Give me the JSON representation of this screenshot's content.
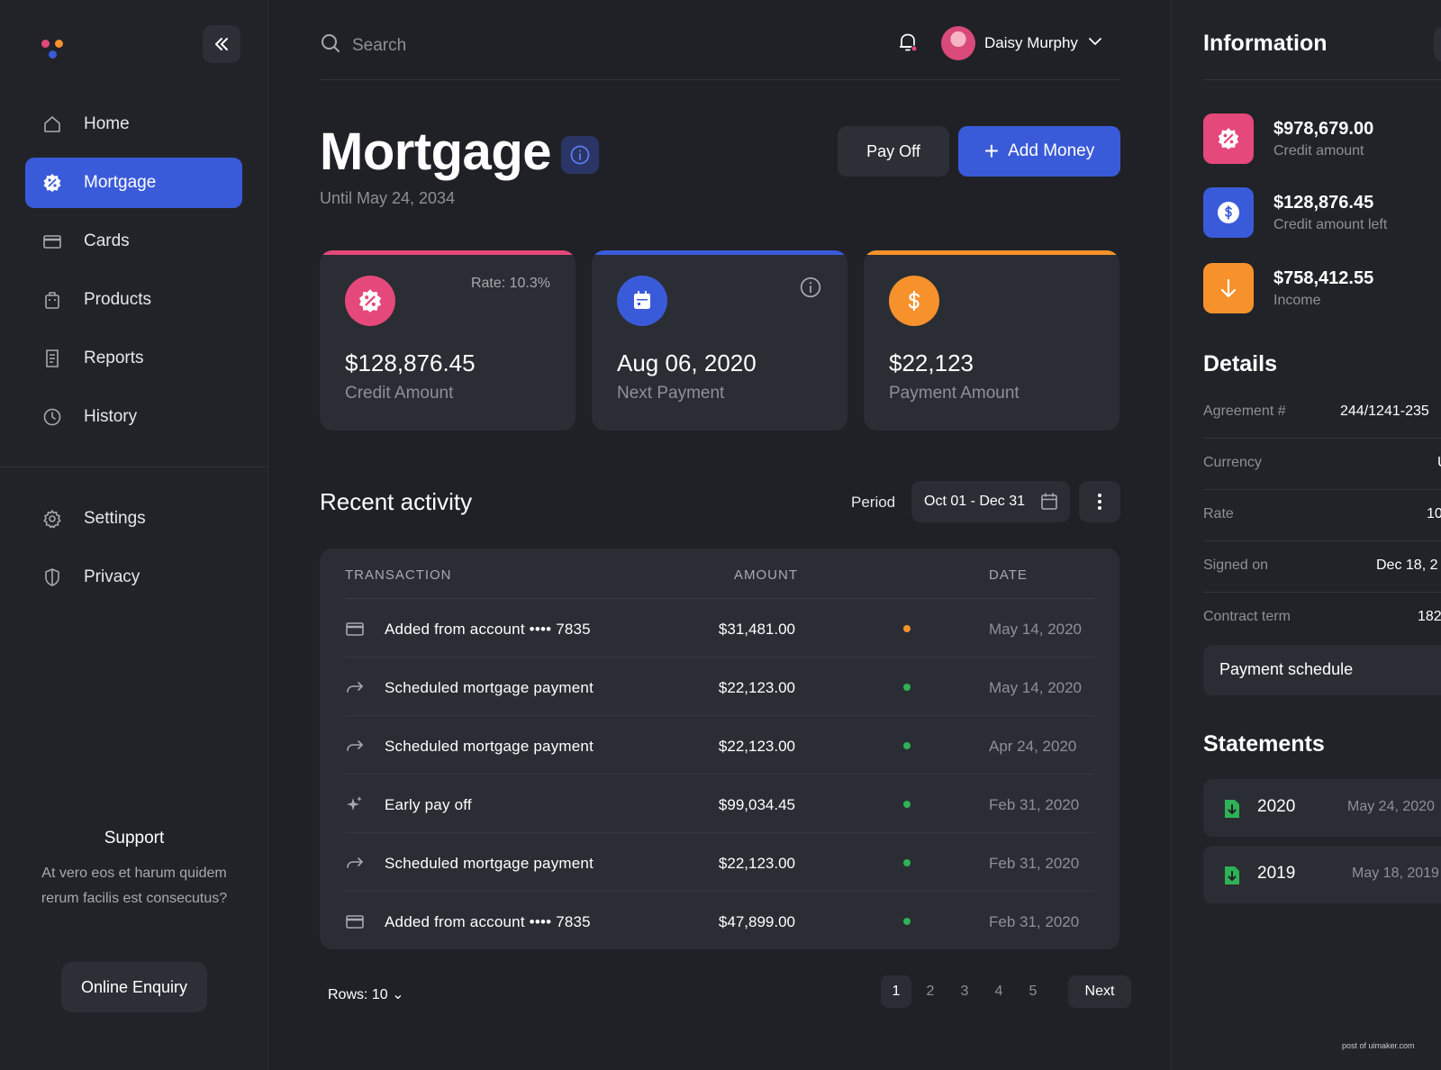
{
  "sidebar": {
    "nav": [
      {
        "label": "Home",
        "icon": "home-icon"
      },
      {
        "label": "Mortgage",
        "icon": "percent-badge-icon",
        "active": true
      },
      {
        "label": "Cards",
        "icon": "card-icon"
      },
      {
        "label": "Products",
        "icon": "bag-icon"
      },
      {
        "label": "Reports",
        "icon": "report-icon"
      },
      {
        "label": "History",
        "icon": "clock-icon"
      }
    ],
    "nav2": [
      {
        "label": "Settings",
        "icon": "gear-icon"
      },
      {
        "label": "Privacy",
        "icon": "shield-icon"
      }
    ],
    "support_title": "Support",
    "support_text": "At vero eos et harum quidem rerum facilis est consecutus?",
    "enquiry_label": "Online Enquiry"
  },
  "header": {
    "search_placeholder": "Search",
    "user_name": "Daisy Murphy"
  },
  "page": {
    "title": "Mortgage",
    "subtitle": "Until May 24, 2034",
    "payoff_label": "Pay Off",
    "addmoney_label": "Add Money"
  },
  "cards": [
    {
      "value": "$128,876.45",
      "label": "Credit Amount",
      "rate": "Rate: 10.3%",
      "color": "#e5487a"
    },
    {
      "value": "Aug 06, 2020",
      "label": "Next Payment",
      "color": "#3a5bd9"
    },
    {
      "value": "$22,123",
      "label": "Payment Amount",
      "color": "#f7912c"
    }
  ],
  "activity": {
    "title": "Recent activity",
    "period_label": "Period",
    "period_value": "Oct 01 - Dec 31",
    "columns": {
      "transaction": "TRANSACTION",
      "amount": "AMOUNT",
      "date": "DATE"
    },
    "rows": [
      {
        "icon": "card-icon",
        "desc": "Added from account •••• 7835",
        "amount": "$31,481.00",
        "status": "#f7912c",
        "date": "May 14, 2020"
      },
      {
        "icon": "share-arrow-icon",
        "desc": "Scheduled mortgage payment",
        "amount": "$22,123.00",
        "status": "#2fb155",
        "date": "May 14, 2020"
      },
      {
        "icon": "share-arrow-icon",
        "desc": "Scheduled mortgage payment",
        "amount": "$22,123.00",
        "status": "#2fb155",
        "date": "Apr 24, 2020"
      },
      {
        "icon": "sparkle-icon",
        "desc": "Early pay off",
        "amount": "$99,034.45",
        "status": "#2fb155",
        "date": "Feb 31, 2020"
      },
      {
        "icon": "share-arrow-icon",
        "desc": "Scheduled mortgage payment",
        "amount": "$22,123.00",
        "status": "#2fb155",
        "date": "Feb 31, 2020"
      },
      {
        "icon": "card-icon",
        "desc": "Added from account •••• 7835",
        "amount": "$47,899.00",
        "status": "#2fb155",
        "date": "Feb 31, 2020"
      }
    ],
    "rows_label": "Rows: 10",
    "pages": [
      "1",
      "2",
      "3",
      "4",
      "5"
    ],
    "next_label": "Next"
  },
  "info": {
    "title": "Information",
    "items": [
      {
        "value": "$978,679.00",
        "label": "Credit amount",
        "color": "#e5487a",
        "icon": "percent-badge-icon"
      },
      {
        "value": "$128,876.45",
        "label": "Credit amount left",
        "color": "#3a5bd9",
        "icon": "dollar-icon"
      },
      {
        "value": "$758,412.55",
        "label": "Income",
        "color": "#f7912c",
        "icon": "arrow-down-icon"
      }
    ]
  },
  "details": {
    "title": "Details",
    "rows": [
      {
        "key": "Agreement #",
        "value": "244/1241-235"
      },
      {
        "key": "Currency",
        "value": "U"
      },
      {
        "key": "Rate",
        "value": "10"
      },
      {
        "key": "Signed on",
        "value": "Dec 18, 2"
      },
      {
        "key": "Contract term",
        "value": "182"
      }
    ],
    "schedule_label": "Payment schedule"
  },
  "statements": {
    "title": "Statements",
    "items": [
      {
        "year": "2020",
        "date": "May 24, 2020"
      },
      {
        "year": "2019",
        "date": "May 18, 2019"
      }
    ]
  },
  "watermark": "post of uimaker.com"
}
